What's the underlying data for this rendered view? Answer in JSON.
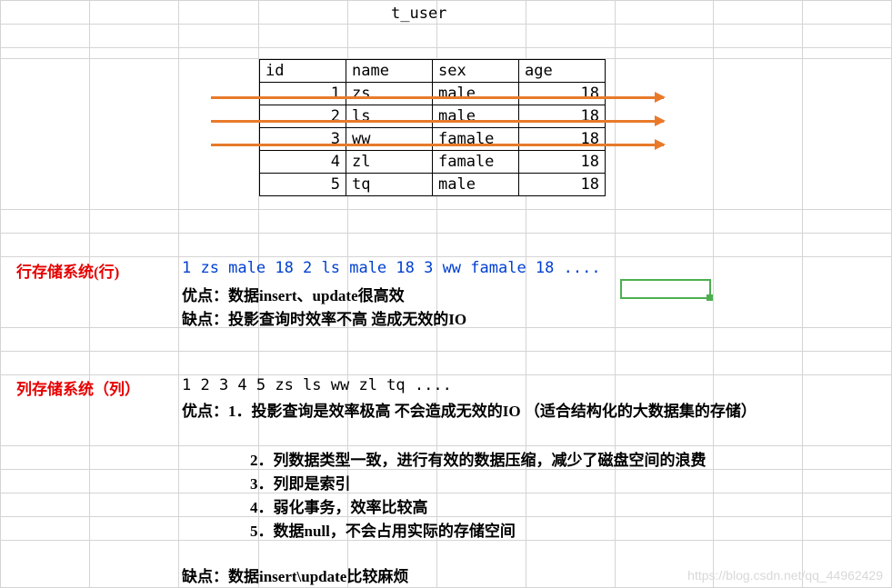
{
  "table": {
    "title": "t_user",
    "headers": [
      "id",
      "name",
      "sex",
      "age"
    ],
    "rows": [
      {
        "id": "1",
        "name": "zs",
        "sex": "male",
        "age": "18"
      },
      {
        "id": "2",
        "name": "ls",
        "sex": "male",
        "age": "18"
      },
      {
        "id": "3",
        "name": "ww",
        "sex": "famale",
        "age": "18"
      },
      {
        "id": "4",
        "name": "zl",
        "sex": "famale",
        "age": "18"
      },
      {
        "id": "5",
        "name": "tq",
        "sex": "male",
        "age": "18"
      }
    ]
  },
  "row_store": {
    "title": "行存储系统(行)",
    "data_line": "1 zs male 18  2 ls male 18 3 ww famale 18 ....",
    "advantage": "优点：数据insert、update很高效",
    "disadvantage": "缺点：投影查询时效率不高   造成无效的IO"
  },
  "col_store": {
    "title": "列存储系统（列）",
    "data_line": "1 2 3 4 5  zs ls ww zl tq ....",
    "advantage_intro": "优点：1．投影查询是效率极高   不会造成无效的IO  （适合结构化的大数据集的存储）",
    "adv2": "2．列数据类型一致，进行有效的数据压缩，减少了磁盘空间的浪费",
    "adv3": "3．列即是索引",
    "adv4": "4．弱化事务，效率比较高",
    "adv5": "5．数据null，不会占用实际的存储空间",
    "disadvantage": "缺点：数据insert\\update比较麻烦"
  },
  "watermark": "https://blog.csdn.net/qq_44962429"
}
